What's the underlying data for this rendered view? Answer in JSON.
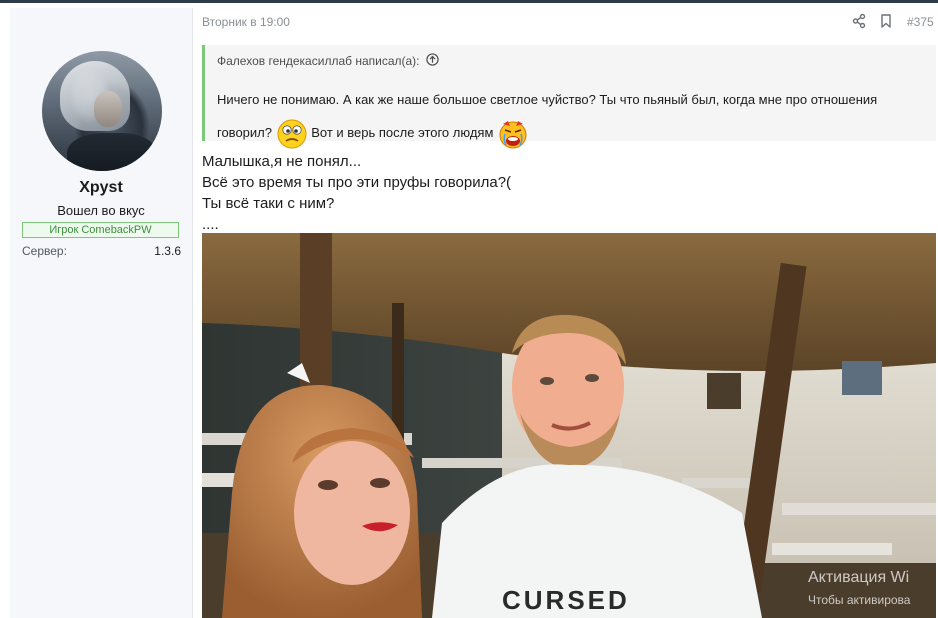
{
  "sidebar": {
    "username": "Xpyst",
    "user_title": "Вошел во вкус",
    "user_banner": "Игрок ComebackPW",
    "server_label": "Сервер:",
    "server_value": "1.3.6"
  },
  "post": {
    "date": "Вторник в 19:00",
    "number": "#375",
    "actions": [
      {
        "icon": "share-icon"
      },
      {
        "icon": "bookmark-icon"
      }
    ]
  },
  "quote": {
    "author_line": "Фалехов гендекасиллаб написал(а):",
    "text_part1": "Ничего не понимаю. А как же наше большое светлое чуйство? Ты что пьяный был, когда мне про отношения говорил?",
    "text_part2": "Вот и верь после этого людям",
    "smiley1": "confused-smiley-icon",
    "smiley2": "crying-smiley-icon"
  },
  "message": {
    "lines": [
      "Малышка,я не понял...",
      "Всё это время ты про эти пруфы говорила?(",
      "Ты всё таки с ним?",
      "...."
    ]
  },
  "photo": {
    "shirt_text": "CURSED"
  },
  "watermark": {
    "title": "Активация Wi",
    "subtitle": "Чтобы активирова"
  },
  "colors": {
    "quote_border": "#7cc97c",
    "banner_text": "#3a8f3a",
    "meta_text": "#8a8f94"
  }
}
